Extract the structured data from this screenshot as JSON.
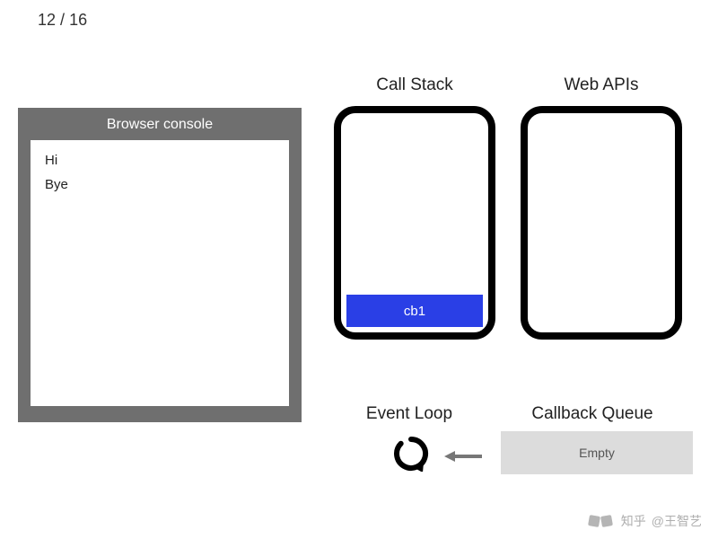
{
  "page": {
    "current": 12,
    "total": 16
  },
  "console": {
    "title": "Browser console",
    "lines": [
      "Hi",
      "Bye"
    ]
  },
  "labels": {
    "callstack": "Call Stack",
    "webapis": "Web APIs",
    "eventloop": "Event Loop",
    "callbackqueue": "Callback Queue"
  },
  "callstack": {
    "frames": [
      "cb1"
    ]
  },
  "webapis": {
    "items": []
  },
  "callback_queue": {
    "status": "Empty",
    "items": []
  },
  "watermark": {
    "brand": "知乎",
    "handle": "@王智艺"
  }
}
